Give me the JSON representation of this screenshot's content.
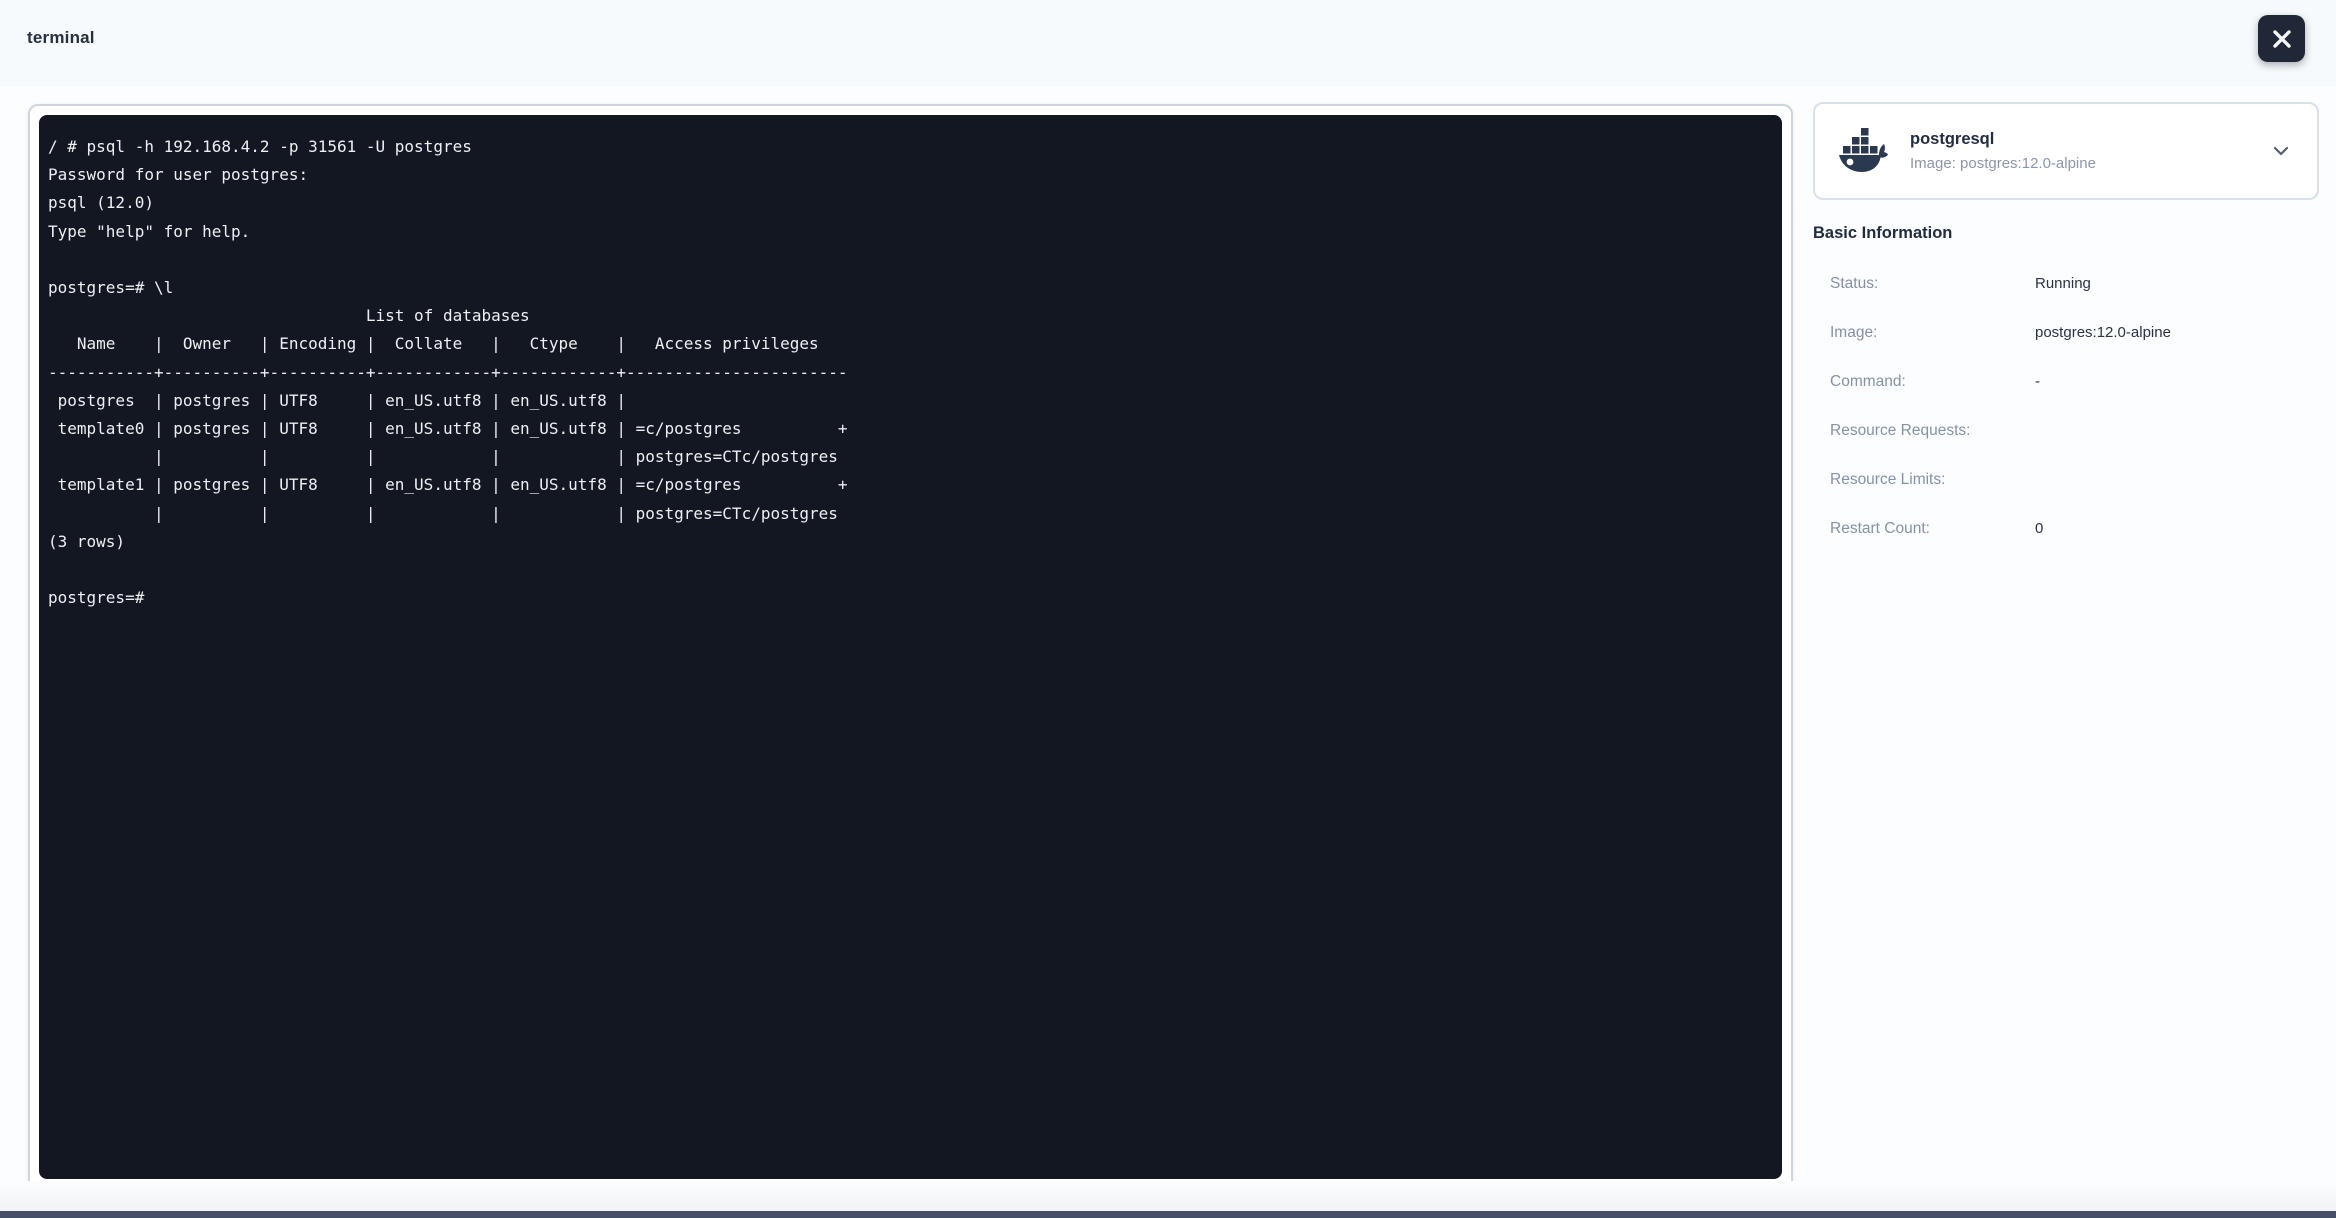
{
  "header": {
    "title": "terminal"
  },
  "terminal": {
    "lines": [
      "/ # psql -h 192.168.4.2 -p 31561 -U postgres",
      "Password for user postgres:",
      "psql (12.0)",
      "Type \"help\" for help.",
      "",
      "postgres=# \\l",
      "                                 List of databases",
      "   Name    |  Owner   | Encoding |  Collate   |   Ctype    |   Access privileges",
      "-----------+----------+----------+------------+------------+-----------------------",
      " postgres  | postgres | UTF8     | en_US.utf8 | en_US.utf8 |",
      " template0 | postgres | UTF8     | en_US.utf8 | en_US.utf8 | =c/postgres          +",
      "           |          |          |            |            | postgres=CTc/postgres",
      " template1 | postgres | UTF8     | en_US.utf8 | en_US.utf8 | =c/postgres          +",
      "           |          |          |            |            | postgres=CTc/postgres",
      "(3 rows)",
      "",
      "postgres=#"
    ]
  },
  "panel": {
    "container_card": {
      "title": "postgresql",
      "subtitle": "Image: postgres:12.0-alpine",
      "icon": "docker-whale-icon",
      "expander_icon": "chevron-down-icon"
    },
    "basic_information": {
      "heading": "Basic Information",
      "rows": [
        {
          "label": "Status:",
          "value": "Running"
        },
        {
          "label": "Image:",
          "value": "postgres:12.0-alpine"
        },
        {
          "label": "Command:",
          "value": "-"
        },
        {
          "label": "Resource Requests:",
          "value": ""
        },
        {
          "label": "Resource Limits:",
          "value": ""
        },
        {
          "label": "Restart Count:",
          "value": "0"
        }
      ]
    }
  },
  "colors": {
    "header_bg": "#f7fafc",
    "terminal_bg": "#131722",
    "terminal_text": "#edeff2",
    "card_border": "#d8e0e9",
    "label_gray": "#8592a6",
    "value_dark": "#2a3244",
    "close_button_bg": "#202737",
    "bottom_bar": "#454f66",
    "docker_icon": "#2b3950"
  }
}
